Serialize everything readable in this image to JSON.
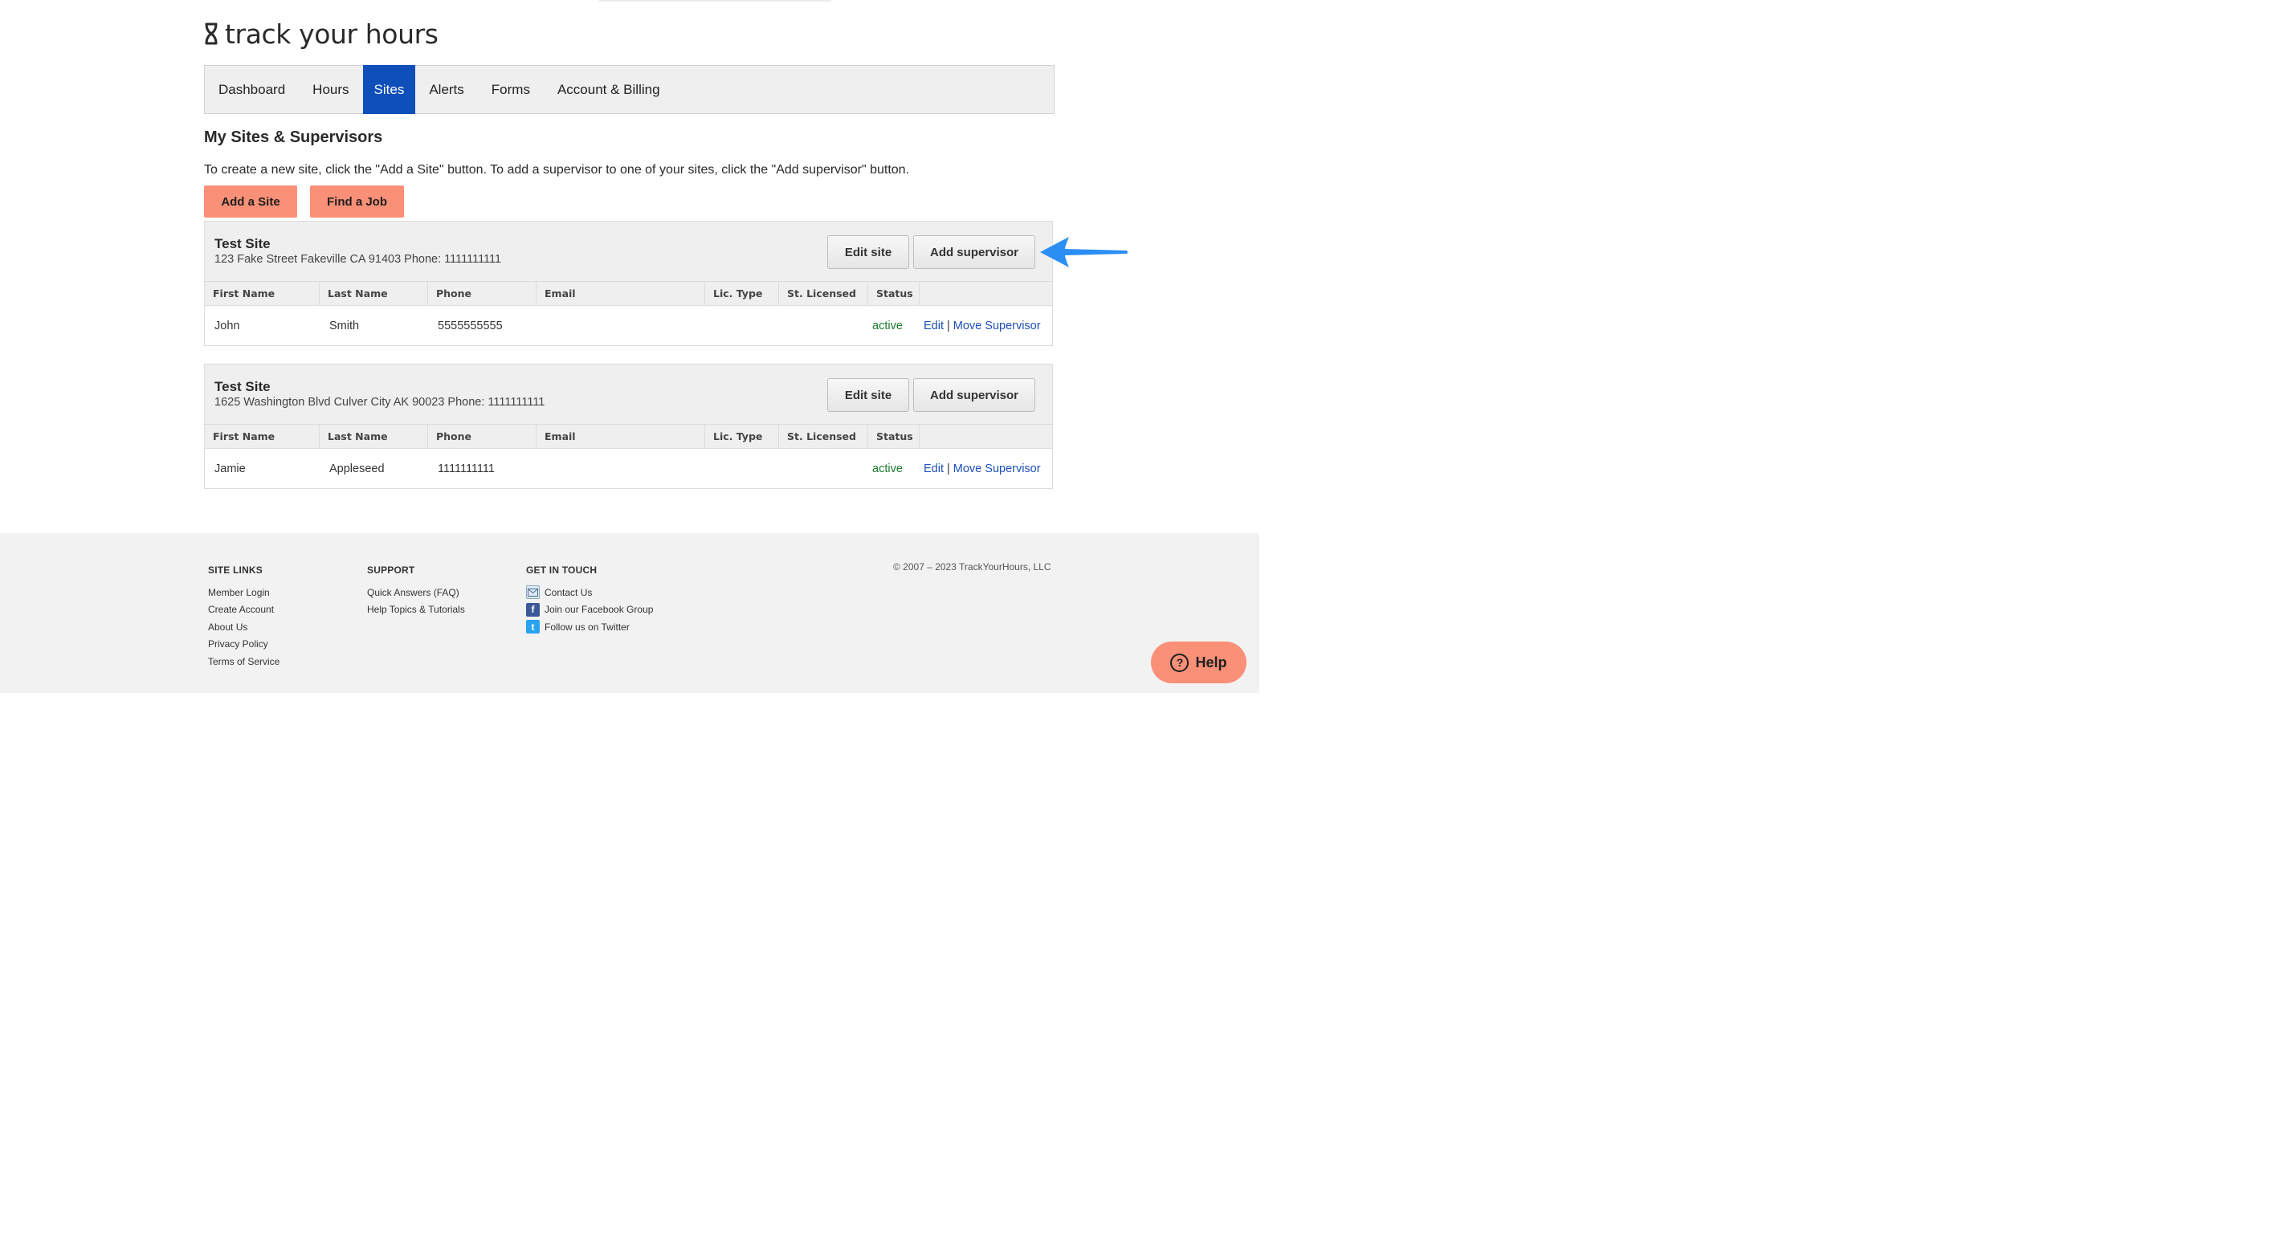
{
  "brand": {
    "name": "track your hours",
    "logo_icon": "hourglass-icon"
  },
  "nav": {
    "items": [
      {
        "label": "Dashboard",
        "active": false
      },
      {
        "label": "Hours",
        "active": false
      },
      {
        "label": "Sites",
        "active": true
      },
      {
        "label": "Alerts",
        "active": false
      },
      {
        "label": "Forms",
        "active": false
      },
      {
        "label": "Account & Billing",
        "active": false
      }
    ],
    "active_color": "#0e4fba"
  },
  "page": {
    "title": "My Sites & Supervisors",
    "intro": "To create a new site, click the \"Add a Site\" button. To add a supervisor to one of your sites, click the \"Add supervisor\" button.",
    "add_site_label": "Add a Site",
    "find_job_label": "Find a Job",
    "cta_color": "#fa9077"
  },
  "table_columns": [
    "First Name",
    "Last Name",
    "Phone",
    "Email",
    "Lic. Type",
    "St. Licensed",
    "Status",
    ""
  ],
  "sites": [
    {
      "name": "Test Site",
      "address": "123 Fake Street Fakeville CA 91403 Phone: 1111111111",
      "edit_label": "Edit site",
      "add_label": "Add supervisor",
      "rows": [
        {
          "first": "John",
          "last": "Smith",
          "phone": "5555555555",
          "email": "",
          "lic_type": "",
          "st_licensed": "",
          "status": "active",
          "edit": "Edit",
          "sep": "|",
          "move": "Move Supervisor"
        }
      ]
    },
    {
      "name": "Test Site",
      "address": "1625 Washington Blvd Culver City AK 90023 Phone: 1111111111",
      "edit_label": "Edit site",
      "add_label": "Add supervisor",
      "rows": [
        {
          "first": "Jamie",
          "last": "Appleseed",
          "phone": "1111111111",
          "email": "",
          "lic_type": "",
          "st_licensed": "",
          "status": "active",
          "edit": "Edit",
          "sep": "|",
          "move": "Move Supervisor"
        }
      ]
    }
  ],
  "annotation": {
    "icon": "arrow-left-icon",
    "color": "#2b8ef5"
  },
  "footer": {
    "site_links": {
      "heading": "SITE LINKS",
      "items": [
        "Member Login",
        "Create Account",
        "About Us",
        "Privacy Policy",
        "Terms of Service"
      ]
    },
    "support": {
      "heading": "SUPPORT",
      "items": [
        "Quick Answers (FAQ)",
        "Help Topics & Tutorials"
      ]
    },
    "get_in_touch": {
      "heading": "GET IN TOUCH",
      "items": [
        {
          "label": "Contact Us",
          "icon": "mail-icon"
        },
        {
          "label": "Join our Facebook Group",
          "icon": "facebook-icon"
        },
        {
          "label": "Follow us on Twitter",
          "icon": "twitter-icon"
        }
      ]
    },
    "copyright": "© 2007 – 2023 TrackYourHours, LLC"
  },
  "help_button": {
    "label": "Help",
    "icon": "question-circle-icon",
    "glyph": "?"
  }
}
